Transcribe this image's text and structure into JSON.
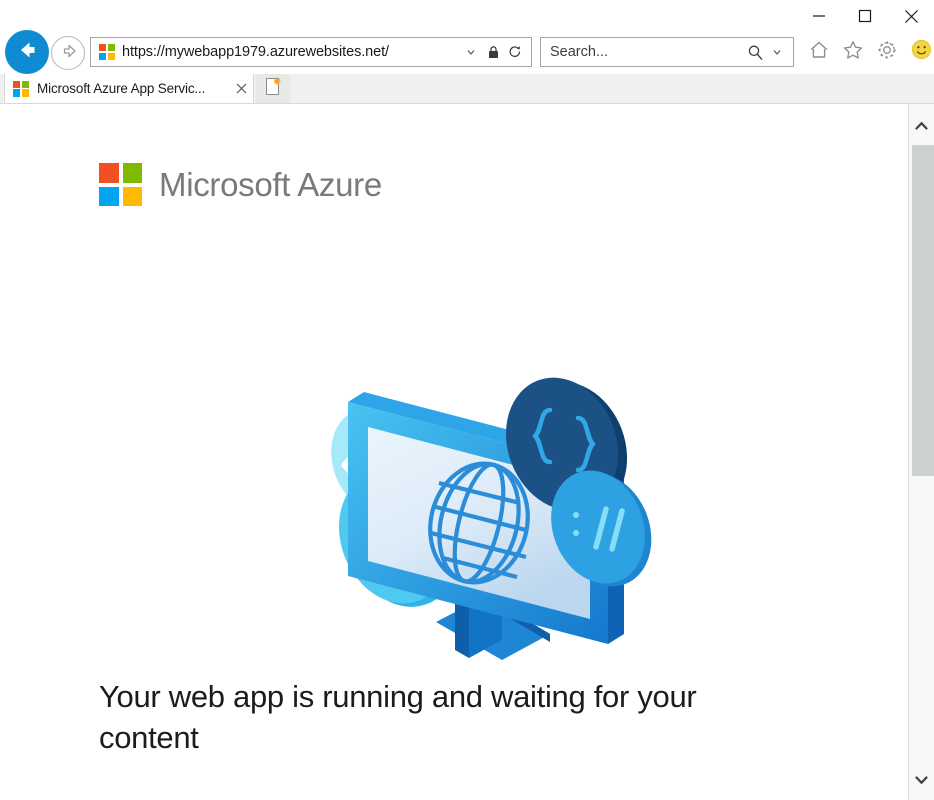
{
  "window": {
    "minimize_label": "Minimize",
    "maximize_label": "Maximize",
    "close_label": "Close"
  },
  "nav": {
    "back_label": "Back",
    "forward_label": "Forward",
    "url": "https://mywebapp1979.azurewebsites.net/",
    "dropdown_label": "Address dropdown",
    "lock_label": "Secure site",
    "refresh_label": "Refresh",
    "home_label": "Home",
    "favorites_label": "Favorites",
    "settings_label": "Settings",
    "feedback_label": "Send a smile"
  },
  "search": {
    "placeholder": "Search...",
    "value": "Search...",
    "search_icon_label": "Search",
    "dropdown_label": "Search options"
  },
  "tabs": {
    "items": [
      {
        "title": "Microsoft Azure App Servic...",
        "close_label": "Close tab"
      }
    ],
    "new_tab_label": "New tab"
  },
  "page": {
    "brand": "Microsoft Azure",
    "headline": "Your web app is running and waiting for your content",
    "illustration_label": "isometric-monitor-globe-illustration"
  },
  "scrollbar": {
    "up_label": "Scroll up",
    "down_label": "Scroll down",
    "thumb_label": "Scroll thumb"
  },
  "colors": {
    "ms_orange": "#F25022",
    "ms_green": "#7FBA00",
    "ms_blue": "#00A4EF",
    "ms_yellow": "#FFB900",
    "back_button_blue": "#0F8BD2",
    "azure_gray": "#7A7A7A",
    "illustration_primary": "#1B8DE0",
    "illustration_dark": "#15497B",
    "illustration_light": "#9FE4F6",
    "scroll_thumb": "#CDD1CF"
  }
}
